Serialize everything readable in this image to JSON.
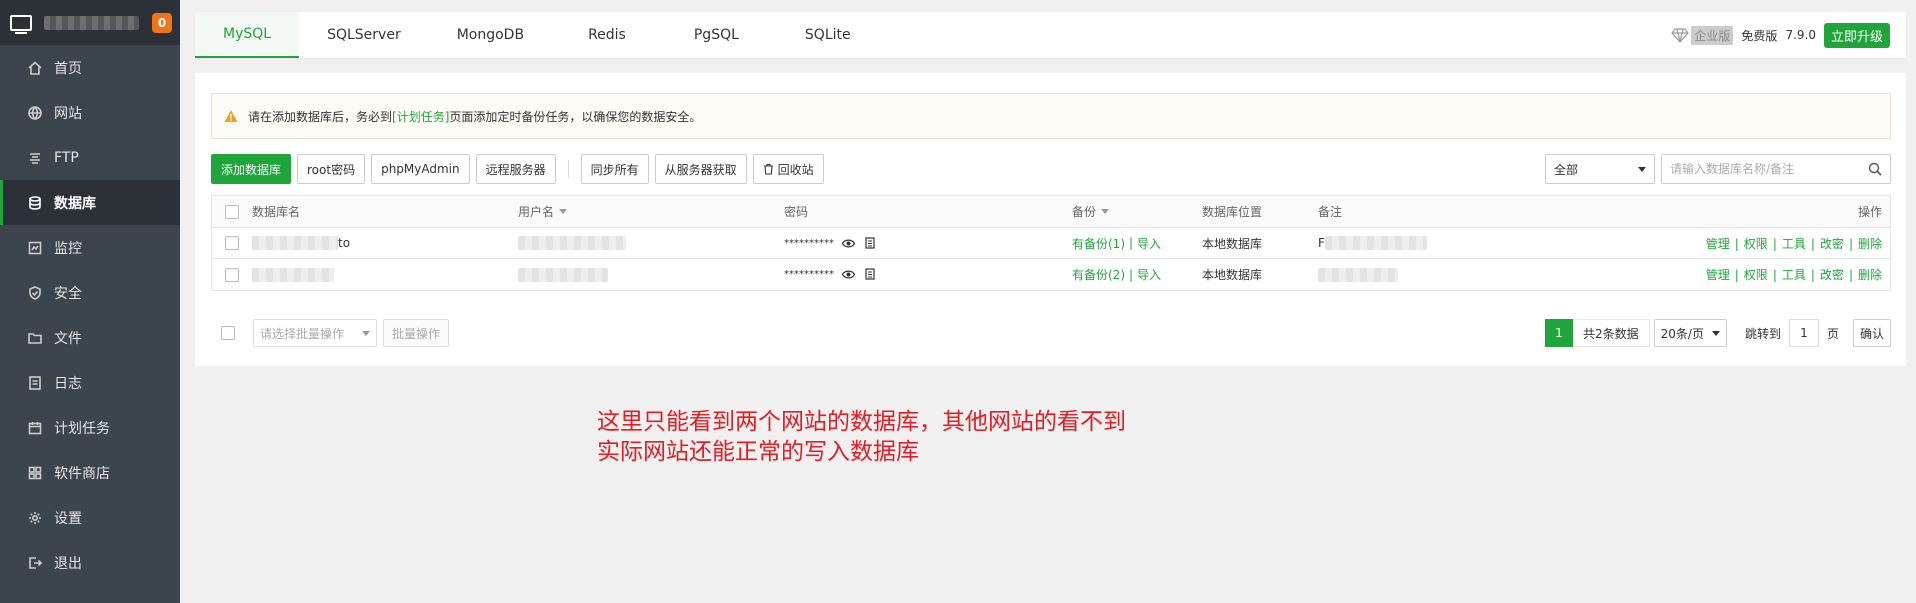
{
  "sidebar": {
    "badge": "0",
    "items": [
      {
        "label": "首页",
        "icon": "home-icon"
      },
      {
        "label": "网站",
        "icon": "globe-icon"
      },
      {
        "label": "FTP",
        "icon": "ftp-icon"
      },
      {
        "label": "数据库",
        "icon": "database-icon",
        "active": true
      },
      {
        "label": "监控",
        "icon": "monitor-icon"
      },
      {
        "label": "安全",
        "icon": "shield-icon"
      },
      {
        "label": "文件",
        "icon": "folder-icon"
      },
      {
        "label": "日志",
        "icon": "log-icon"
      },
      {
        "label": "计划任务",
        "icon": "calendar-icon"
      },
      {
        "label": "软件商店",
        "icon": "store-icon"
      },
      {
        "label": "设置",
        "icon": "gear-icon"
      },
      {
        "label": "退出",
        "icon": "logout-icon"
      }
    ]
  },
  "tabs": [
    "MySQL",
    "SQLServer",
    "MongoDB",
    "Redis",
    "PgSQL",
    "SQLite"
  ],
  "header": {
    "enterprise_label": "企业版",
    "free_label": "免费版",
    "version": "7.9.0",
    "upgrade_label": "立即升级"
  },
  "warning": {
    "prefix": "请在添加数据库后，务必到",
    "link": "[计划任务]",
    "suffix": "页面添加定时备份任务，以确保您的数据安全。"
  },
  "toolbar": {
    "add_db": "添加数据库",
    "root_pw": "root密码",
    "phpmyadmin": "phpMyAdmin",
    "remote": "远程服务器",
    "sync_all": "同步所有",
    "from_server": "从服务器获取",
    "recycle": "回收站",
    "filter_value": "全部",
    "search_placeholder": "请输入数据库名称/备注"
  },
  "table": {
    "headers": {
      "name": "数据库名",
      "user": "用户名",
      "password": "密码",
      "backup": "备份",
      "location": "数据库位置",
      "note": "备注",
      "ops": "操作"
    },
    "rows": [
      {
        "name_suffix": "to",
        "password": "**********",
        "backup": "有备份(1)",
        "import": "导入",
        "location": "本地数据库",
        "note_prefix": "F"
      },
      {
        "name_suffix": "",
        "password": "**********",
        "backup": "有备份(2)",
        "import": "导入",
        "location": "本地数据库",
        "note_prefix": ""
      }
    ],
    "ops": [
      "管理",
      "权限",
      "工具",
      "改密",
      "删除"
    ]
  },
  "footer": {
    "batch_placeholder": "请选择批量操作",
    "batch_button": "批量操作",
    "current_page": "1",
    "total": "共2条数据",
    "page_size": "20条/页",
    "jump_label": "跳转到",
    "jump_value": "1",
    "page_unit": "页",
    "confirm": "确认"
  },
  "annotation": {
    "line1": "这里只能看到两个网站的数据库，其他网站的看不到",
    "line2": "实际网站还能正常的写入数据库"
  }
}
